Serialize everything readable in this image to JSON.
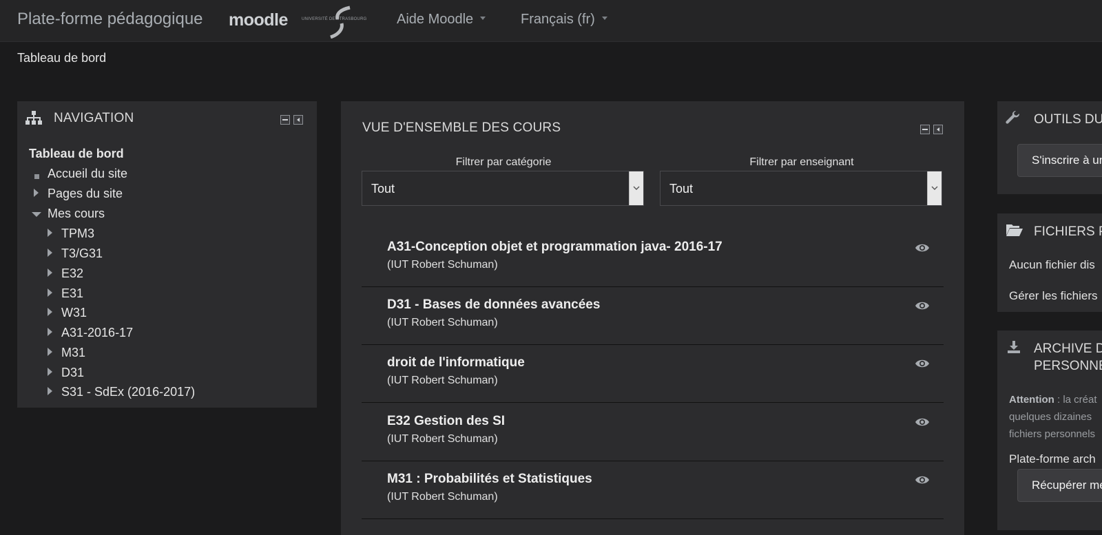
{
  "header": {
    "brand": "Plate-forme pédagogique",
    "logo_moodle": "moodle",
    "logo_university": "UNIVERSITÉ DE STRASBOURG",
    "menu_help": "Aide Moodle",
    "menu_lang": "Français (fr)"
  },
  "breadcrumb": {
    "current": "Tableau de bord"
  },
  "navigation": {
    "title": "NAVIGATION",
    "root": "Tableau de bord",
    "items": [
      {
        "label": "Accueil du site"
      },
      {
        "label": "Pages du site"
      },
      {
        "label": "Mes cours"
      }
    ],
    "courses": [
      "TPM3",
      "T3/G31",
      "E32",
      "E31",
      "W31",
      "A31-2016-17",
      "M31",
      "D31",
      "S31 - SdEx (2016-2017)"
    ]
  },
  "overview": {
    "title": "VUE D'ENSEMBLE DES COURS",
    "filter_category_label": "Filtrer par catégorie",
    "filter_category_value": "Tout",
    "filter_teacher_label": "Filtrer par enseignant",
    "filter_teacher_value": "Tout",
    "courses": [
      {
        "title": "A31-Conception objet et programmation java- 2016-17",
        "subtitle": "(IUT Robert Schuman)"
      },
      {
        "title": "D31 - Bases de données avancées",
        "subtitle": "(IUT Robert Schuman)"
      },
      {
        "title": "droit de l'informatique",
        "subtitle": "(IUT Robert Schuman)"
      },
      {
        "title": "E32 Gestion des SI",
        "subtitle": "(IUT Robert Schuman)"
      },
      {
        "title": "M31 : Probabilités et Statistiques",
        "subtitle": "(IUT Robert Schuman)"
      }
    ]
  },
  "right": {
    "tools_title": "OUTILS DU",
    "enrol_button": "S'inscrire à un",
    "files_title": "FICHIERS P",
    "files_empty": "Aucun fichier dis",
    "files_manage": "Gérer les fichiers",
    "archive_title_1": "ARCHIVE DE",
    "archive_title_2": "PERSONNE",
    "archive_attention": "Attention",
    "archive_text_1": " : la créat",
    "archive_text_2": "quelques dizaines",
    "archive_text_3": "fichiers personnels",
    "archive_platform": "Plate-forme arch",
    "archive_button": "Récupérer me"
  },
  "colors": {
    "background": "#1b1b1c",
    "block": "#2c2c2e",
    "topbar": "#252526"
  }
}
